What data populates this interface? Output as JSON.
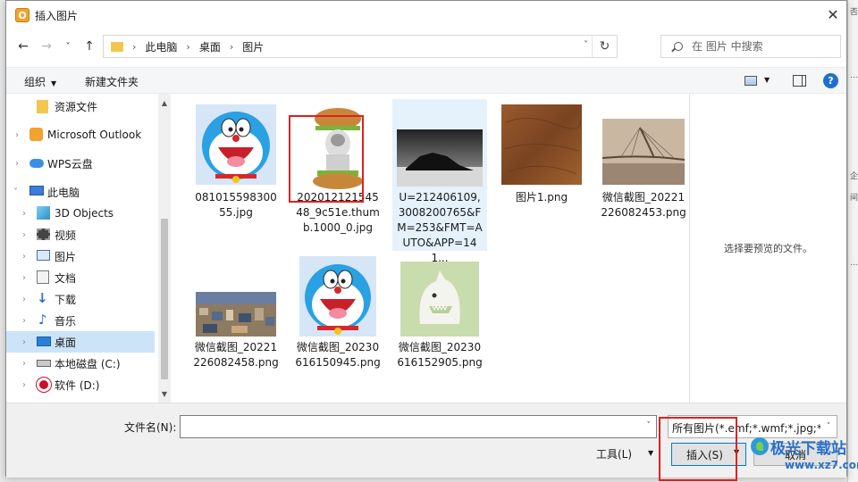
{
  "window": {
    "title": "插入图片",
    "app_icon_letter": "O",
    "close_glyph": "✕"
  },
  "nav": {
    "back": "←",
    "forward": "→",
    "recent": "˅",
    "up": "↑",
    "crumb_sep": "›",
    "breadcrumbs": [
      "此电脑",
      "桌面",
      "图片"
    ],
    "address_dropdown": "˅",
    "refresh": "↻",
    "search_placeholder": "在 图片 中搜索"
  },
  "toolbar": {
    "organize": "组织",
    "organize_caret": "▼",
    "new_folder": "新建文件夹",
    "view_caret": "▼",
    "help": "?"
  },
  "sidebar": {
    "items": [
      {
        "label": "资源文件",
        "icon": "folder-icon",
        "expander": "",
        "selected": false
      },
      {
        "label": "Microsoft Outlook",
        "icon": "outlook-icon",
        "expander": "›",
        "selected": false
      },
      {
        "label": "WPS云盘",
        "icon": "cloud-icon",
        "expander": "›",
        "selected": false
      },
      {
        "label": "此电脑",
        "icon": "computer-icon",
        "expander": "˅",
        "selected": false
      },
      {
        "label": "3D Objects",
        "icon": "3d-objects-icon",
        "expander": "›",
        "selected": false
      },
      {
        "label": "视频",
        "icon": "video-icon",
        "expander": "›",
        "selected": false
      },
      {
        "label": "图片",
        "icon": "pictures-icon",
        "expander": "›",
        "selected": false
      },
      {
        "label": "文档",
        "icon": "documents-icon",
        "expander": "›",
        "selected": false
      },
      {
        "label": "下载",
        "icon": "download-icon",
        "expander": "›",
        "selected": false
      },
      {
        "label": "音乐",
        "icon": "music-icon",
        "expander": "›",
        "selected": false
      },
      {
        "label": "桌面",
        "icon": "desktop-icon",
        "expander": "›",
        "selected": true
      },
      {
        "label": "本地磁盘 (C:)",
        "icon": "drive-icon",
        "expander": "›",
        "selected": false
      },
      {
        "label": "软件 (D:)",
        "icon": "drive-d-icon",
        "expander": "›",
        "selected": false
      }
    ],
    "scroll_up": "▲",
    "scroll_down": "▼"
  },
  "files": [
    {
      "name": "08101559830055.jpg",
      "thumb": "doraemon"
    },
    {
      "name": "20201212154548_9c51e.thumb.1000_0.jpg",
      "thumb": "sandwich-cat"
    },
    {
      "name": "U=212406109,3008200765&FM=253&FMT=AUTO&APP=141...",
      "thumb": "rock"
    },
    {
      "name": "图片1.png",
      "thumb": "leather"
    },
    {
      "name": "微信截图_20221226082453.png",
      "thumb": "bridge"
    },
    {
      "name": "微信截图_20221226082458.png",
      "thumb": "city"
    },
    {
      "name": "微信截图_20230616150945.png",
      "thumb": "doraemon"
    },
    {
      "name": "微信截图_20230616152905.png",
      "thumb": "monster"
    }
  ],
  "preview": {
    "placeholder": "选择要预览的文件。"
  },
  "bottom": {
    "filename_label": "文件名(N):",
    "filename_value": "",
    "filetype": "所有图片(*.emf;*.wmf;*.jpg;*.jp",
    "dropdown_glyph": "˅",
    "tools": "工具(L)",
    "tools_caret": "▼",
    "insert": "插入(S)",
    "insert_caret": "▼",
    "cancel": "取消"
  },
  "watermark": {
    "text": "极光下载站",
    "url": "www.xz7.com"
  },
  "right_strip": [
    "否",
    "...",
    "企",
    "间",
    "..."
  ],
  "colors": {
    "accent": "#0078d7",
    "highlight_red": "#e02020",
    "selected_bg": "#cce4f7"
  }
}
